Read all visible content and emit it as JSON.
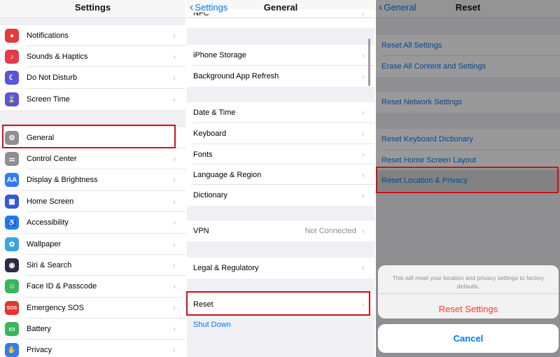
{
  "settings": {
    "title": "Settings",
    "items": [
      {
        "label": "Notifications",
        "icon": "notifications-icon",
        "color": "#e53a36",
        "glyph": "●"
      },
      {
        "label": "Sounds & Haptics",
        "icon": "speaker-icon",
        "color": "#e53a47",
        "glyph": "♪"
      },
      {
        "label": "Do Not Disturb",
        "icon": "moon-icon",
        "color": "#5b54d6",
        "glyph": "☾"
      },
      {
        "label": "Screen Time",
        "icon": "hourglass-icon",
        "color": "#5b54d6",
        "glyph": "⌛"
      },
      {
        "label": "General",
        "icon": "gear-icon",
        "color": "#8e8e93",
        "glyph": "⚙"
      },
      {
        "label": "Control Center",
        "icon": "toggles-icon",
        "color": "#8e8e93",
        "glyph": "⚌"
      },
      {
        "label": "Display & Brightness",
        "icon": "text-size-icon",
        "color": "#2f7cf6",
        "glyph": "AA"
      },
      {
        "label": "Home Screen",
        "icon": "app-grid-icon",
        "color": "#3558d6",
        "glyph": "▦"
      },
      {
        "label": "Accessibility",
        "icon": "accessibility-icon",
        "color": "#1e7cf0",
        "glyph": "♿"
      },
      {
        "label": "Wallpaper",
        "icon": "flower-icon",
        "color": "#38a6e0",
        "glyph": "✿"
      },
      {
        "label": "Siri & Search",
        "icon": "siri-icon",
        "color": "#2b2b45",
        "glyph": "◉"
      },
      {
        "label": "Face ID & Passcode",
        "icon": "face-id-icon",
        "color": "#3bb55b",
        "glyph": "☺"
      },
      {
        "label": "Emergency SOS",
        "icon": "sos-icon",
        "color": "#e5342f",
        "glyph": "SOS"
      },
      {
        "label": "Battery",
        "icon": "battery-icon",
        "color": "#3bb55b",
        "glyph": "▭"
      },
      {
        "label": "Privacy",
        "icon": "hand-icon",
        "color": "#2f7cf6",
        "glyph": "✋"
      }
    ]
  },
  "general": {
    "back_label": "Settings",
    "title": "General",
    "top_partial": "NFC",
    "group1": [
      "iPhone Storage",
      "Background App Refresh"
    ],
    "group2": [
      "Date & Time",
      "Keyboard",
      "Fonts",
      "Language & Region",
      "Dictionary"
    ],
    "vpn_label": "VPN",
    "vpn_value": "Not Connected",
    "legal_label": "Legal & Regulatory",
    "reset_label": "Reset",
    "shutdown_label": "Shut Down"
  },
  "reset": {
    "back_label": "General",
    "title": "Reset",
    "group1": [
      "Reset All Settings",
      "Erase All Content and Settings"
    ],
    "group2": [
      "Reset Network Settings"
    ],
    "group3": [
      "Reset Keyboard Dictionary",
      "Reset Home Screen Layout",
      "Reset Location & Privacy"
    ]
  },
  "action_sheet": {
    "message": "This will reset your location and privacy settings to factory defaults.",
    "confirm_label": "Reset Settings",
    "cancel_label": "Cancel",
    "confirm_color": "#ff3b30",
    "cancel_color": "#007aff"
  },
  "highlight_color": "#d0101a"
}
